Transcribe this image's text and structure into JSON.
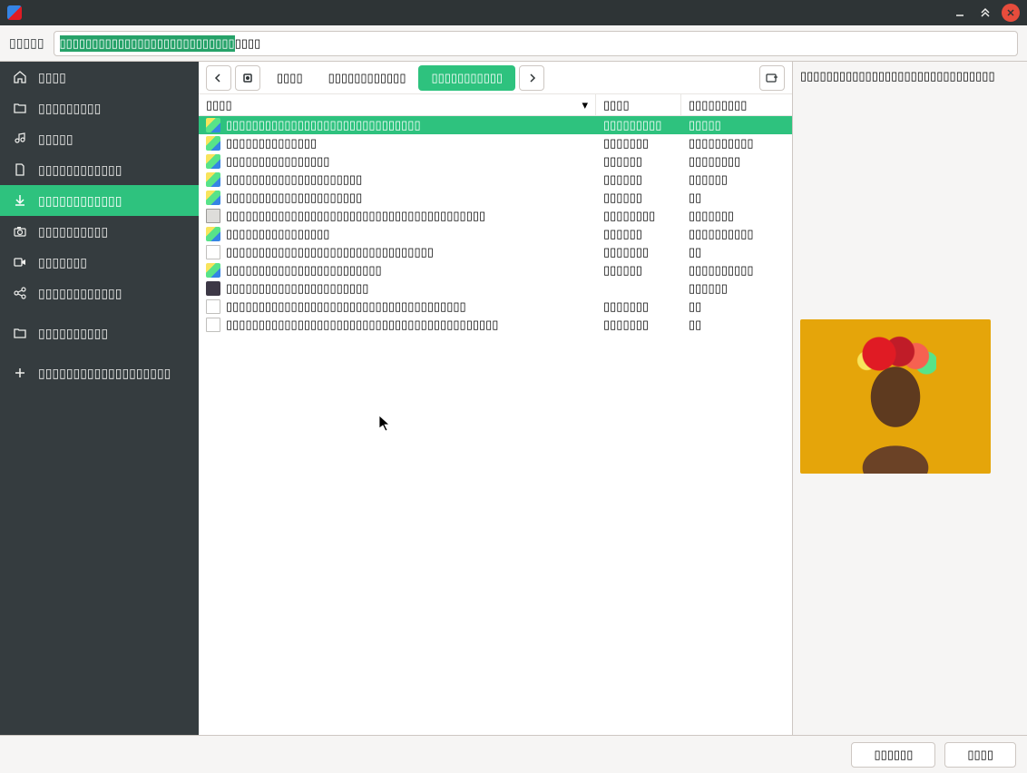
{
  "titlebar": {
    "app_name": ""
  },
  "toolbar": {
    "label": "▯▯▯▯▯",
    "location_highlighted": "▯▯▯▯▯▯▯▯▯▯▯▯▯▯▯▯▯▯▯▯▯▯▯▯▯▯▯",
    "location_rest": "▯▯▯▯"
  },
  "sidebar": {
    "items": [
      {
        "id": "home",
        "label": "▯▯▯▯",
        "icon": "home-icon"
      },
      {
        "id": "desktop",
        "label": "▯▯▯▯▯▯▯▯▯",
        "icon": "folder-icon"
      },
      {
        "id": "music",
        "label": "▯▯▯▯▯",
        "icon": "music-icon"
      },
      {
        "id": "documents",
        "label": "▯▯▯▯▯▯▯▯▯▯▯▯",
        "icon": "document-icon"
      },
      {
        "id": "downloads",
        "label": "▯▯▯▯▯▯▯▯▯▯▯▯",
        "icon": "download-icon",
        "selected": true
      },
      {
        "id": "pictures",
        "label": "▯▯▯▯▯▯▯▯▯▯",
        "icon": "camera-icon"
      },
      {
        "id": "videos",
        "label": "▯▯▯▯▯▯▯",
        "icon": "video-icon"
      },
      {
        "id": "share",
        "label": "▯▯▯▯▯▯▯▯▯▯▯▯",
        "icon": "share-icon"
      }
    ],
    "items2": [
      {
        "id": "other",
        "label": "▯▯▯▯▯▯▯▯▯▯",
        "icon": "folder-icon"
      }
    ],
    "items3": [
      {
        "id": "add",
        "label": "▯▯▯▯▯▯▯▯▯▯▯▯▯▯▯▯▯▯▯",
        "icon": "plus-icon"
      }
    ]
  },
  "breadcrumb": {
    "segments": [
      {
        "label": "▯▯▯▯"
      },
      {
        "label": "▯▯▯▯▯▯▯▯▯▯▯▯"
      },
      {
        "label": "▯▯▯▯▯▯▯▯▯▯▯",
        "current": true
      }
    ]
  },
  "columns": {
    "name": "▯▯▯▯",
    "size": "▯▯▯▯",
    "modified": "▯▯▯▯▯▯▯▯▯"
  },
  "files": [
    {
      "name": "▯▯▯▯▯▯▯▯▯▯▯▯▯▯▯▯▯▯▯▯▯▯▯▯▯▯▯▯▯▯",
      "size": "▯▯▯▯▯▯▯▯▯",
      "modified": "▯▯▯▯▯",
      "icon": "folder-color",
      "selected": true
    },
    {
      "name": "▯▯▯▯▯▯▯▯▯▯▯▯▯▯",
      "size": "▯▯▯▯▯▯▯",
      "modified": "▯▯▯▯▯▯▯▯▯▯",
      "icon": "folder-color"
    },
    {
      "name": "▯▯▯▯▯▯▯▯▯▯▯▯▯▯▯▯",
      "size": "▯▯▯▯▯▯",
      "modified": "▯▯▯▯▯▯▯▯",
      "icon": "folder-color"
    },
    {
      "name": "▯▯▯▯▯▯▯▯▯▯▯▯▯▯▯▯▯▯▯▯▯",
      "size": "▯▯▯▯▯▯",
      "modified": "▯▯▯▯▯▯",
      "icon": "folder-color"
    },
    {
      "name": "▯▯▯▯▯▯▯▯▯▯▯▯▯▯▯▯▯▯▯▯▯",
      "size": "▯▯▯▯▯▯",
      "modified": "▯▯",
      "icon": "folder-color"
    },
    {
      "name": "▯▯▯▯▯▯▯▯▯▯▯▯▯▯▯▯▯▯▯▯▯▯▯▯▯▯▯▯▯▯▯▯▯▯▯▯▯▯▯▯",
      "size": "▯▯▯▯▯▯▯▯",
      "modified": "▯▯▯▯▯▯▯",
      "icon": "box"
    },
    {
      "name": "▯▯▯▯▯▯▯▯▯▯▯▯▯▯▯▯",
      "size": "▯▯▯▯▯▯",
      "modified": "▯▯▯▯▯▯▯▯▯▯",
      "icon": "folder-color"
    },
    {
      "name": "▯▯▯▯▯▯▯▯▯▯▯▯▯▯▯▯▯▯▯▯▯▯▯▯▯▯▯▯▯▯▯▯",
      "size": "▯▯▯▯▯▯▯",
      "modified": "▯▯",
      "icon": "doc"
    },
    {
      "name": "▯▯▯▯▯▯▯▯▯▯▯▯▯▯▯▯▯▯▯▯▯▯▯▯",
      "size": "▯▯▯▯▯▯",
      "modified": "▯▯▯▯▯▯▯▯▯▯",
      "icon": "folder-color"
    },
    {
      "name": "▯▯▯▯▯▯▯▯▯▯▯▯▯▯▯▯▯▯▯▯▯▯",
      "size": "",
      "modified": "▯▯▯▯▯▯",
      "icon": "folder-dark"
    },
    {
      "name": "▯▯▯▯▯▯▯▯▯▯▯▯▯▯▯▯▯▯▯▯▯▯▯▯▯▯▯▯▯▯▯▯▯▯▯▯▯",
      "size": "▯▯▯▯▯▯▯",
      "modified": "▯▯",
      "icon": "doc"
    },
    {
      "name": "▯▯▯▯▯▯▯▯▯▯▯▯▯▯▯▯▯▯▯▯▯▯▯▯▯▯▯▯▯▯▯▯▯▯▯▯▯▯▯▯▯▯",
      "size": "▯▯▯▯▯▯▯",
      "modified": "▯▯",
      "icon": "doc"
    }
  ],
  "preview": {
    "filename": "▯▯▯▯▯▯▯▯▯▯▯▯▯▯▯▯▯▯▯▯▯▯▯▯▯▯▯▯▯▯"
  },
  "footer": {
    "cancel": "▯▯▯▯▯▯",
    "open": "▯▯▯▯"
  }
}
